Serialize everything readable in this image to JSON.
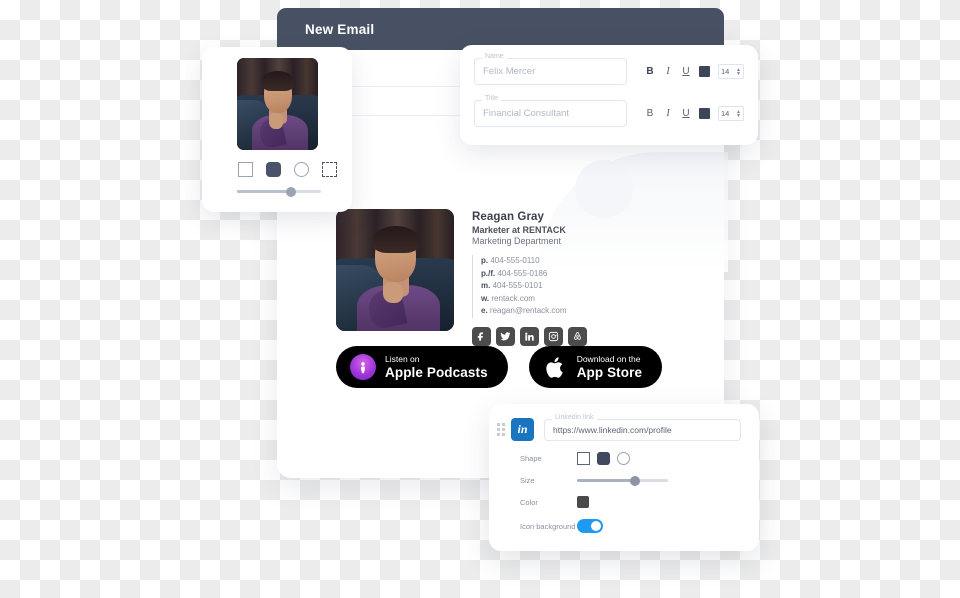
{
  "window": {
    "title": "New Email"
  },
  "image_card": {
    "name": "image-settings",
    "shapes": [
      {
        "id": "square",
        "selected": false
      },
      {
        "id": "rounded",
        "selected": true
      },
      {
        "id": "circle",
        "selected": false
      },
      {
        "id": "dashed",
        "selected": false
      }
    ],
    "size_slider_value": 60
  },
  "form": {
    "fields": [
      {
        "label": "Name",
        "value": "Felix Mercer",
        "toolbar": {
          "bold": "B",
          "italic": "I",
          "underline": "U",
          "color": "#3d4558",
          "size": "14"
        }
      },
      {
        "label": "Title",
        "value": "Financial Consultant",
        "toolbar": {
          "bold": "B",
          "italic": "I",
          "underline": "U",
          "color": "#3d4558",
          "size": "14"
        }
      }
    ]
  },
  "signature": {
    "name": "Reagan Gray",
    "role": "Marketer at RENTACK",
    "department": "Marketing Department",
    "contacts": [
      {
        "key": "p.",
        "value": "404-555-0110"
      },
      {
        "key": "p./f.",
        "value": "404-555-0186"
      },
      {
        "key": "m.",
        "value": "404-555-0101"
      },
      {
        "key": "w.",
        "value": "rentack.com"
      },
      {
        "key": "e.",
        "value": "reagan@rentack.com"
      }
    ],
    "socials": [
      "facebook-icon",
      "twitter-icon",
      "linkedin-icon",
      "instagram-icon",
      "airbnb-icon"
    ]
  },
  "badges": [
    {
      "id": "apple-podcasts-badge",
      "small": "Listen on",
      "large": "Apple Podcasts",
      "icon": "podcast-icon"
    },
    {
      "id": "app-store-badge",
      "small": "Download on the",
      "large": "App Store",
      "icon": "apple-icon"
    }
  ],
  "linkedin_panel": {
    "icon": "linkedin-icon",
    "icon_text": "in",
    "field_label": "Linkedin link",
    "field_value": "https://www.linkedin.com/profile",
    "rows": {
      "shape_label": "Shape",
      "size_label": "Size",
      "color_label": "Color",
      "icon_background_label": "Icon background"
    },
    "shapes": [
      {
        "id": "square",
        "selected": false
      },
      {
        "id": "rounded",
        "selected": true
      },
      {
        "id": "circle",
        "selected": false
      }
    ],
    "size_value": 62,
    "color_value": "#4a4a4a",
    "icon_background_on": true,
    "toggle_color": "#1e9bf0"
  }
}
